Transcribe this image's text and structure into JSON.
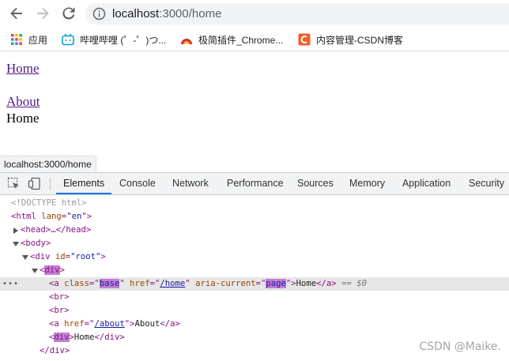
{
  "browser": {
    "url_host": "localhost",
    "url_path": ":3000/home",
    "bookmarks": [
      {
        "label": "应用"
      },
      {
        "label": "哔哩哔哩 (゜-゜)つ..."
      },
      {
        "label": "极简插件_Chrome..."
      },
      {
        "label": "内容管理-CSDN博客"
      }
    ],
    "status_url": "localhost:3000/home"
  },
  "page": {
    "link_home": "Home",
    "link_about": "About",
    "content": "Home"
  },
  "devtools": {
    "tabs": [
      "Elements",
      "Console",
      "Network",
      "Performance",
      "Sources",
      "Memory",
      "Application",
      "Security"
    ],
    "active_tab": "Elements",
    "dom": {
      "doctype": "<!DOCTYPE html>",
      "html_open": "<html",
      "html_attr": "lang",
      "html_val": "\"en\"",
      "head": "<head>…</head>",
      "body_open": "<body>",
      "div_open": "<div",
      "div_attr": "id",
      "div_val": "\"root\"",
      "inner_div": "div",
      "a_home_class_val": "base",
      "a_home_href_val": "/home",
      "a_home_aria_val": "page",
      "a_home_text": "Home",
      "dollar_zero": "== $0",
      "br": "<br>",
      "a_about_href_val": "/about",
      "a_about_text": "About",
      "div_home_text": "Home",
      "div_close": "</div>"
    }
  },
  "watermark": "CSDN @Maike."
}
